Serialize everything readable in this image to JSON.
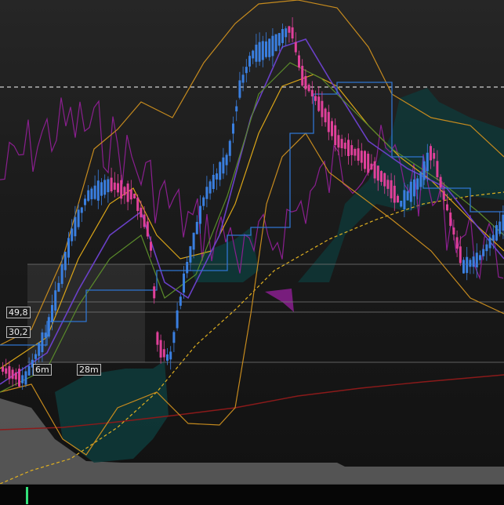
{
  "chart_data": {
    "type": "candlestick",
    "title": "",
    "xlabel": "",
    "ylabel": "",
    "grid": false,
    "price_levels": [
      "49,8",
      "30,2"
    ],
    "time_markers": [
      "6m",
      "28m"
    ],
    "colors": {
      "up_candle": "#3a7fe0",
      "down_candle": "#e0409a",
      "cloud": "#0e3b3b",
      "baseline_band": "#6b6b6b",
      "upper_envelope": "#c58a1e",
      "purple_line": "#8a1f8f",
      "ma_long": "#8b1a1a",
      "ma_dashed": "#e0b020",
      "signal_marker": "#33e07a"
    }
  }
}
